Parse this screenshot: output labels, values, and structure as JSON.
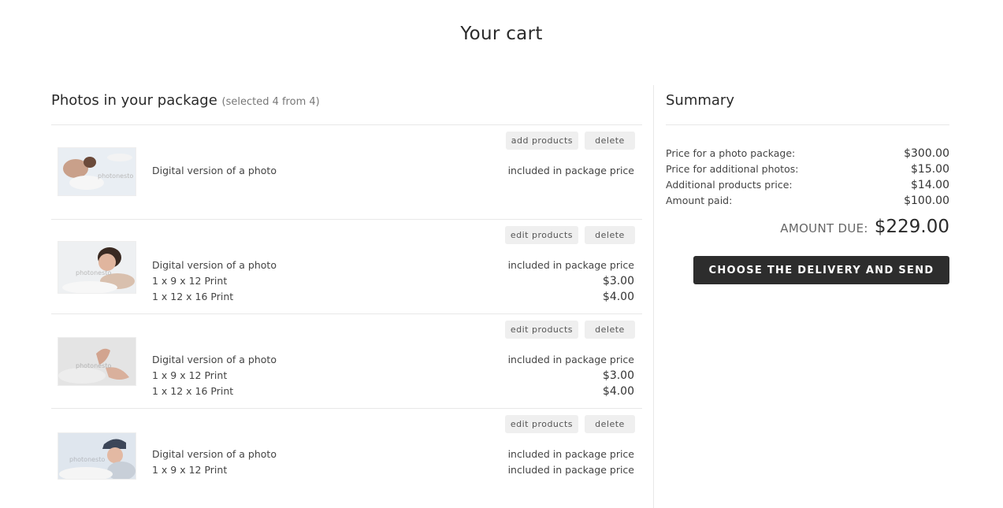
{
  "page": {
    "title": "Your cart"
  },
  "package": {
    "title": "Photos in your package",
    "subtitle": "(selected 4 from 4)",
    "items": [
      {
        "buttons": {
          "primary": "add products",
          "delete": "delete"
        },
        "lines": [
          "Digital version of a photo"
        ],
        "prices": [
          "included in package price"
        ],
        "thumb": {
          "bg": "#e9eef3",
          "accent": "#b7876e"
        }
      },
      {
        "buttons": {
          "primary": "edit products",
          "delete": "delete"
        },
        "lines": [
          "Digital version of a photo",
          "1 x 9 x 12 Print",
          "1 x 12 x 16 Print"
        ],
        "prices": [
          "included in package price",
          "$3.00",
          "$4.00"
        ],
        "thumb": {
          "bg": "#eef0f2",
          "accent": "#8a6a55"
        }
      },
      {
        "buttons": {
          "primary": "edit products",
          "delete": "delete"
        },
        "lines": [
          "Digital version of a photo",
          "1 x 9 x 12 Print",
          "1 x 12 x 16 Print"
        ],
        "prices": [
          "included in package price",
          "$3.00",
          "$4.00"
        ],
        "thumb": {
          "bg": "#e4e4e4",
          "accent": "#d2a48f"
        }
      },
      {
        "buttons": {
          "primary": "edit products",
          "delete": "delete"
        },
        "lines": [
          "Digital version of a photo",
          "1 x 9 x 12 Print"
        ],
        "prices": [
          "included in package price",
          "included in package price"
        ],
        "thumb": {
          "bg": "#dfe6ee",
          "accent": "#3c4658"
        }
      }
    ]
  },
  "summary": {
    "title": "Summary",
    "rows": [
      {
        "label": "Price for a photo package:",
        "value": "$300.00"
      },
      {
        "label": "Price for additional photos:",
        "value": "$15.00"
      },
      {
        "label": "Additional products price:",
        "value": "$14.00"
      },
      {
        "label": "Amount paid:",
        "value": "$100.00"
      }
    ],
    "amount_due_label": "AMOUNT DUE:",
    "amount_due_value": "$229.00",
    "send_button": "CHOOSE THE DELIVERY AND SEND"
  },
  "icons": {
    "thumbnail": "photo-thumbnail"
  },
  "colors": {
    "button_dark": "#2d2d2d",
    "button_light": "#efefef"
  }
}
